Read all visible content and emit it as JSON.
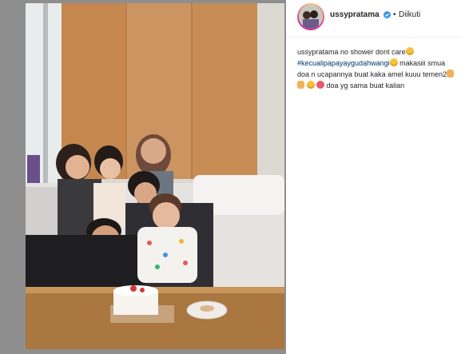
{
  "post": {
    "username": "ussypratama",
    "follow_separator": "•",
    "follow_status": "Diikuti",
    "caption_parts": {
      "user": "ussypratama",
      "line1_text": " no shower dont care",
      "hashtag": "#kecualipapayaygudahwangi",
      "line2_text": " makasiii smua doa n ucapannya buat kaka amel kuuu temen2",
      "line3_text": " doa yg sama buat kalian"
    }
  },
  "colors": {
    "backdrop": "#8e8e8e",
    "panel": "#ffffff",
    "link": "#00376b",
    "verified": "#3897f0"
  },
  "icons": [
    "verified-badge-icon",
    "avatar",
    "emoji-grin-icon",
    "emoji-pray-icon",
    "emoji-heart-eyes-icon"
  ]
}
